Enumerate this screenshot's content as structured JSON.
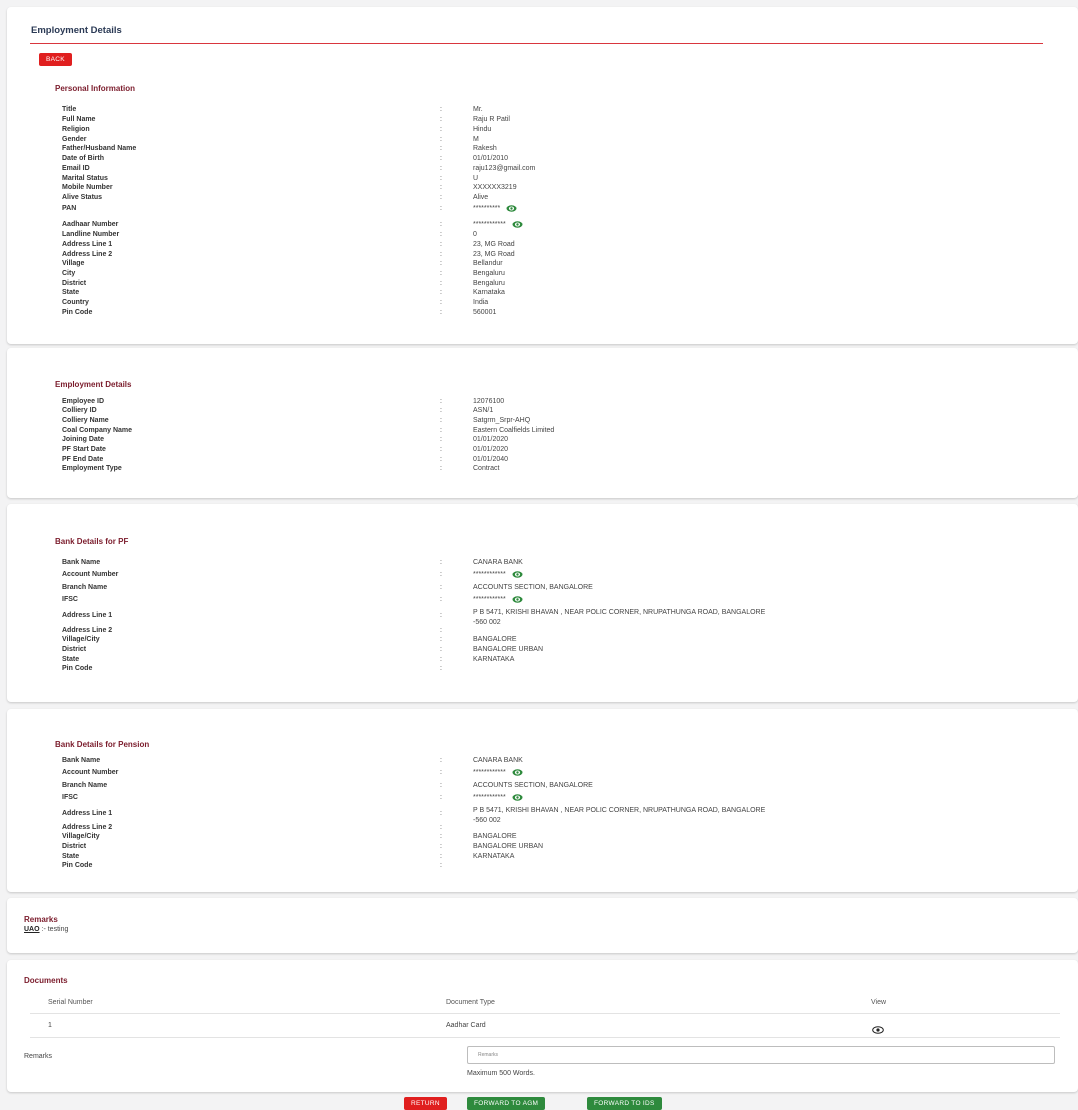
{
  "page_title": "Employment Details",
  "back_label": "BACK",
  "personal": {
    "title": "Personal Information",
    "rows": [
      {
        "label": "Title",
        "value": "Mr."
      },
      {
        "label": "Full Name",
        "value": "Raju R Patil"
      },
      {
        "label": "Religion",
        "value": "Hindu"
      },
      {
        "label": "Gender",
        "value": "M"
      },
      {
        "label": "Father/Husband Name",
        "value": "Rakesh"
      },
      {
        "label": "Date of Birth",
        "value": "01/01/2010"
      },
      {
        "label": "Email ID",
        "value": "raju123@gmail.com"
      },
      {
        "label": "Marital Status",
        "value": "U"
      },
      {
        "label": "Mobile Number",
        "value": "XXXXXX3219"
      },
      {
        "label": "Alive Status",
        "value": "Alive"
      },
      {
        "label": "PAN",
        "value": "**********"
      },
      {
        "label": "Aadhaar Number",
        "value": "************"
      },
      {
        "label": "Landline Number",
        "value": "0"
      },
      {
        "label": "Address Line 1",
        "value": "23, MG Road"
      },
      {
        "label": "Address Line 2",
        "value": "23, MG Road"
      },
      {
        "label": "Village",
        "value": "Bellandur"
      },
      {
        "label": "City",
        "value": "Bengaluru"
      },
      {
        "label": "District",
        "value": "Bengaluru"
      },
      {
        "label": "State",
        "value": "Karnataka"
      },
      {
        "label": "Country",
        "value": "India"
      },
      {
        "label": "Pin Code",
        "value": "560001"
      }
    ]
  },
  "employment": {
    "title": "Employment Details",
    "rows": [
      {
        "label": "Employee ID",
        "value": "12076100"
      },
      {
        "label": "Colliery ID",
        "value": "ASN/1"
      },
      {
        "label": "Colliery Name",
        "value": "Satgrm_Srpr-AHQ"
      },
      {
        "label": "Coal Company Name",
        "value": "Eastern Coalfields Limited"
      },
      {
        "label": "Joining Date",
        "value": "01/01/2020"
      },
      {
        "label": "PF Start Date",
        "value": "01/01/2020"
      },
      {
        "label": "PF End Date",
        "value": "01/01/2040"
      },
      {
        "label": "Employment Type",
        "value": "Contract"
      }
    ]
  },
  "bank_pf": {
    "title": "Bank Details for PF",
    "rows": [
      {
        "label": "Bank Name",
        "value": "CANARA BANK"
      },
      {
        "label": "Account Number",
        "value": "************"
      },
      {
        "label": "Branch Name",
        "value": "ACCOUNTS SECTION, BANGALORE"
      },
      {
        "label": "IFSC",
        "value": "************"
      },
      {
        "label": "Address Line 1",
        "value": "P B 5471, KRISHI BHAVAN , NEAR POLIC CORNER, NRUPATHUNGA ROAD, BANGALORE -560 002"
      },
      {
        "label": "Address Line 2",
        "value": ""
      },
      {
        "label": "Village/City",
        "value": "BANGALORE"
      },
      {
        "label": "District",
        "value": "BANGALORE URBAN"
      },
      {
        "label": "State",
        "value": "KARNATAKA"
      },
      {
        "label": "Pin Code",
        "value": ""
      }
    ]
  },
  "bank_pension": {
    "title": "Bank Details for Pension",
    "rows": [
      {
        "label": "Bank Name",
        "value": "CANARA BANK"
      },
      {
        "label": "Account Number",
        "value": "************"
      },
      {
        "label": "Branch Name",
        "value": "ACCOUNTS SECTION, BANGALORE"
      },
      {
        "label": "IFSC",
        "value": "************"
      },
      {
        "label": "Address Line 1",
        "value": "P B 5471, KRISHI BHAVAN , NEAR POLIC CORNER, NRUPATHUNGA ROAD, BANGALORE -560 002"
      },
      {
        "label": "Address Line 2",
        "value": ""
      },
      {
        "label": "Village/City",
        "value": "BANGALORE"
      },
      {
        "label": "District",
        "value": "BANGALORE URBAN"
      },
      {
        "label": "State",
        "value": "KARNATAKA"
      },
      {
        "label": "Pin Code",
        "value": ""
      }
    ]
  },
  "remarks_section": {
    "title": "Remarks",
    "author": "UAO",
    "text": ":- testing"
  },
  "documents": {
    "title": "Documents",
    "headers": {
      "serial": "Serial Number",
      "type": "Document Type",
      "view": "View"
    },
    "rows": [
      {
        "serial": "1",
        "type": "Aadhar Card"
      }
    ],
    "remarks_label": "Remarks",
    "remarks_placeholder": "Remarks",
    "remarks_hint": "Maximum 500 Words."
  },
  "actions": {
    "return_label": "RETURN",
    "forward_agm_label": "FORWARD TO AGM",
    "forward_ids_label": "FORWARD TO IDS"
  },
  "colors": {
    "accent_red": "#e01f1f",
    "section_maroon": "#7b1c2c",
    "eye_green": "#2e8a3d",
    "button_green": "#2e8a3d"
  }
}
